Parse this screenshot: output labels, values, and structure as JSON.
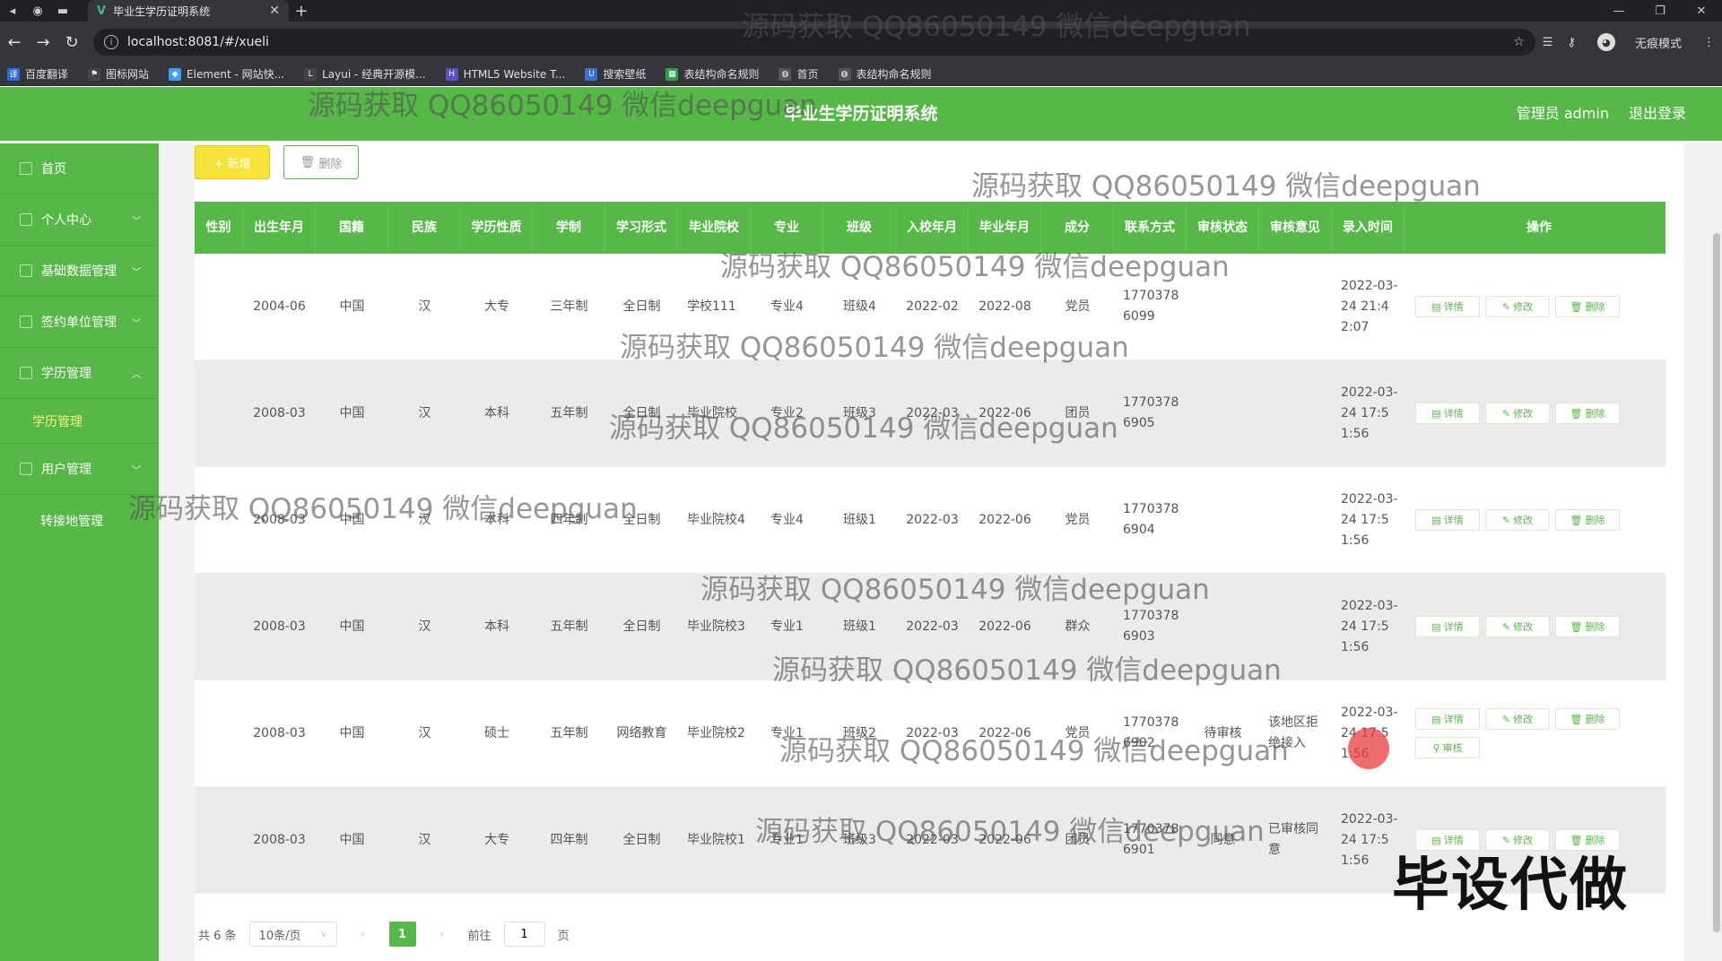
{
  "browser": {
    "tab_title": "毕业生学历证明系统",
    "url": "localhost:8081/#/xueli",
    "incognito_label": "无痕模式",
    "bookmarks": [
      "百度翻译",
      "图标网站",
      "Element - 网站快...",
      "Layui - 经典开源模...",
      "HTML5 Website T...",
      "搜索壁纸",
      "表结构命名规则",
      "首页",
      "表结构命名规则"
    ]
  },
  "header": {
    "title": "毕业生学历证明系统",
    "admin": "管理员 admin",
    "logout": "退出登录"
  },
  "sidebar": {
    "items": [
      "首页",
      "个人中心",
      "基础数据管理",
      "签约单位管理",
      "学历管理",
      "学历管理",
      "用户管理",
      "转接地管理"
    ]
  },
  "toolbar": {
    "add": "+ 新增",
    "delete": "删除"
  },
  "table": {
    "columns": [
      "性别",
      "出生年月",
      "国籍",
      "民族",
      "学历性质",
      "学制",
      "学习形式",
      "毕业院校",
      "专业",
      "班级",
      "入校年月",
      "毕业年月",
      "成分",
      "联系方式",
      "审核状态",
      "审核意见",
      "录入时间",
      "操作"
    ],
    "rows": [
      [
        "",
        "2004-06",
        "中国",
        "汉",
        "大专",
        "三年制",
        "全日制",
        "学校111",
        "专业4",
        "班级4",
        "2022-02",
        "2022-08",
        "党员",
        "17703786099",
        "",
        "",
        "2022-03-24 21:42:07"
      ],
      [
        "",
        "2008-03",
        "中国",
        "汉",
        "本科",
        "五年制",
        "全日制",
        "毕业院校",
        "专业2",
        "班级3",
        "2022-03",
        "2022-06",
        "团员",
        "17703786905",
        "",
        "",
        "2022-03-24 17:51:56"
      ],
      [
        "",
        "2008-03",
        "中国",
        "汉",
        "本科",
        "四年制",
        "全日制",
        "毕业院校4",
        "专业4",
        "班级1",
        "2022-03",
        "2022-06",
        "党员",
        "17703786904",
        "",
        "",
        "2022-03-24 17:51:56"
      ],
      [
        "",
        "2008-03",
        "中国",
        "汉",
        "本科",
        "五年制",
        "全日制",
        "毕业院校3",
        "专业1",
        "班级1",
        "2022-03",
        "2022-06",
        "群众",
        "17703786903",
        "",
        "",
        "2022-03-24 17:51:56"
      ],
      [
        "",
        "2008-03",
        "中国",
        "汉",
        "硕士",
        "五年制",
        "网络教育",
        "毕业院校2",
        "专业1",
        "班级2",
        "2022-03",
        "2022-06",
        "党员",
        "17703786902",
        "待审核",
        "该地区拒绝接入",
        "2022-03-24 17:51:56"
      ],
      [
        "",
        "2008-03",
        "中国",
        "汉",
        "大专",
        "四年制",
        "全日制",
        "毕业院校1",
        "专业1",
        "班级3",
        "2022-03",
        "2022-06",
        "团员",
        "17703786901",
        "同意",
        "已审核同意",
        "2022-03-24 17:51:56"
      ]
    ],
    "actions": {
      "detail": "详情",
      "edit": "修改",
      "delete": "删除",
      "review": "审核"
    }
  },
  "pagination": {
    "total": "共 6 条",
    "page_size": "10条/页",
    "current": "1",
    "goto_label": "前往",
    "goto_value": "1",
    "page_unit": "页"
  },
  "overlay": {
    "watermark": "源码获取 QQ86050149 微信deepguan",
    "stamp": "毕设代做"
  },
  "colors": {
    "primary": "#55b847",
    "add_button": "#f6e43b",
    "submenu_active": "#f6f77a"
  }
}
